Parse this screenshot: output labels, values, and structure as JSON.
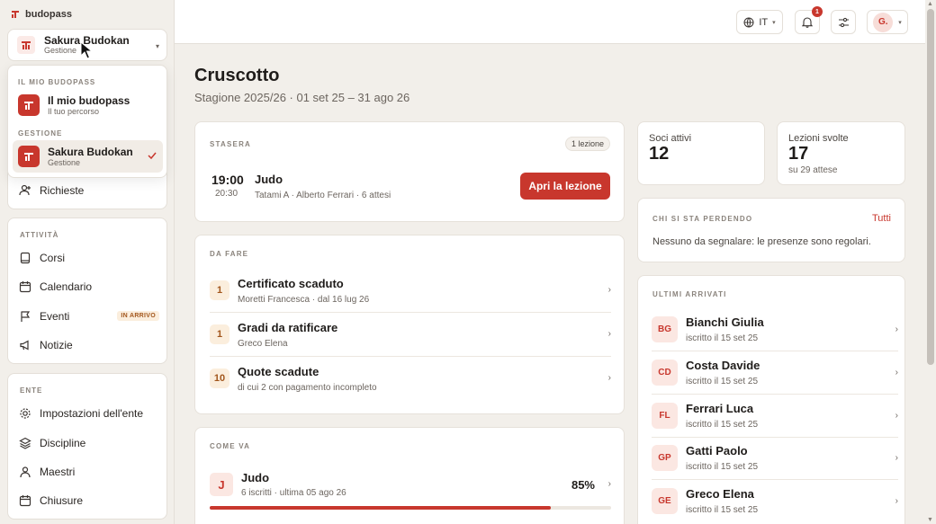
{
  "brand": {
    "name": "budopass"
  },
  "entity_switch": {
    "name": "Sakura Budokan",
    "role": "Gestione"
  },
  "dropdown": {
    "section_mine": "IL MIO BUDOPASS",
    "mine_title": "Il mio budopass",
    "mine_sub": "Il tuo percorso",
    "section_manage": "GESTIONE",
    "manage_title": "Sakura Budokan",
    "manage_sub": "Gestione"
  },
  "sidebar": {
    "requests": "Richieste",
    "section_activity": "ATTIVITÀ",
    "activity": [
      {
        "label": "Corsi"
      },
      {
        "label": "Calendario"
      },
      {
        "label": "Eventi",
        "badge": "IN ARRIVO"
      },
      {
        "label": "Notizie"
      }
    ],
    "section_entity": "ENTE",
    "entity": [
      {
        "label": "Impostazioni dell'ente"
      },
      {
        "label": "Discipline"
      },
      {
        "label": "Maestri"
      },
      {
        "label": "Chiusure"
      }
    ]
  },
  "topbar": {
    "language": "IT",
    "notifications": "1",
    "avatar": "G."
  },
  "page": {
    "title": "Cruscotto",
    "subtitle": "Stagione 2025/26 · 01 set 25 – 31 ago 26"
  },
  "tonight": {
    "label": "STASERA",
    "pill": "1 lezione",
    "start": "19:00",
    "end": "20:30",
    "name": "Judo",
    "meta": "Tatami A · Alberto Ferrari · 6 attesi",
    "button": "Apri la lezione"
  },
  "todo": {
    "label": "DA FARE",
    "items": [
      {
        "count": "1",
        "title": "Certificato scaduto",
        "sub": "Moretti Francesca · dal 16 lug 26"
      },
      {
        "count": "1",
        "title": "Gradi da ratificare",
        "sub": "Greco Elena"
      },
      {
        "count": "10",
        "title": "Quote scadute",
        "sub": "di cui 2 con pagamento incompleto"
      }
    ]
  },
  "progress": {
    "label": "COME VA",
    "course_initial": "J",
    "course_name": "Judo",
    "course_meta": "6 iscritti · ultima 05 ago 26",
    "percent": "85%",
    "fill": 0.85
  },
  "stats": {
    "active_members_label": "Soci attivi",
    "active_members_value": "12",
    "lessons_label": "Lezioni svolte",
    "lessons_value": "17",
    "lessons_sub": "su 29 attese"
  },
  "losing": {
    "label": "CHI SI STA PERDENDO",
    "link": "Tutti",
    "message": "Nessuno da segnalare: le presenze sono regolari."
  },
  "arrivals": {
    "label": "ULTIMI ARRIVATI",
    "items": [
      {
        "initials": "BG",
        "name": "Bianchi Giulia",
        "sub": "iscritto il 15 set 25"
      },
      {
        "initials": "CD",
        "name": "Costa Davide",
        "sub": "iscritto il 15 set 25"
      },
      {
        "initials": "FL",
        "name": "Ferrari Luca",
        "sub": "iscritto il 15 set 25"
      },
      {
        "initials": "GP",
        "name": "Gatti Paolo",
        "sub": "iscritto il 15 set 25"
      },
      {
        "initials": "GE",
        "name": "Greco Elena",
        "sub": "iscritto il 15 set 25"
      }
    ]
  },
  "colors": {
    "accent": "#c8372d",
    "background": "#f2efea",
    "warn_bg": "#fbeedd",
    "warn_fg": "#a2561c"
  }
}
